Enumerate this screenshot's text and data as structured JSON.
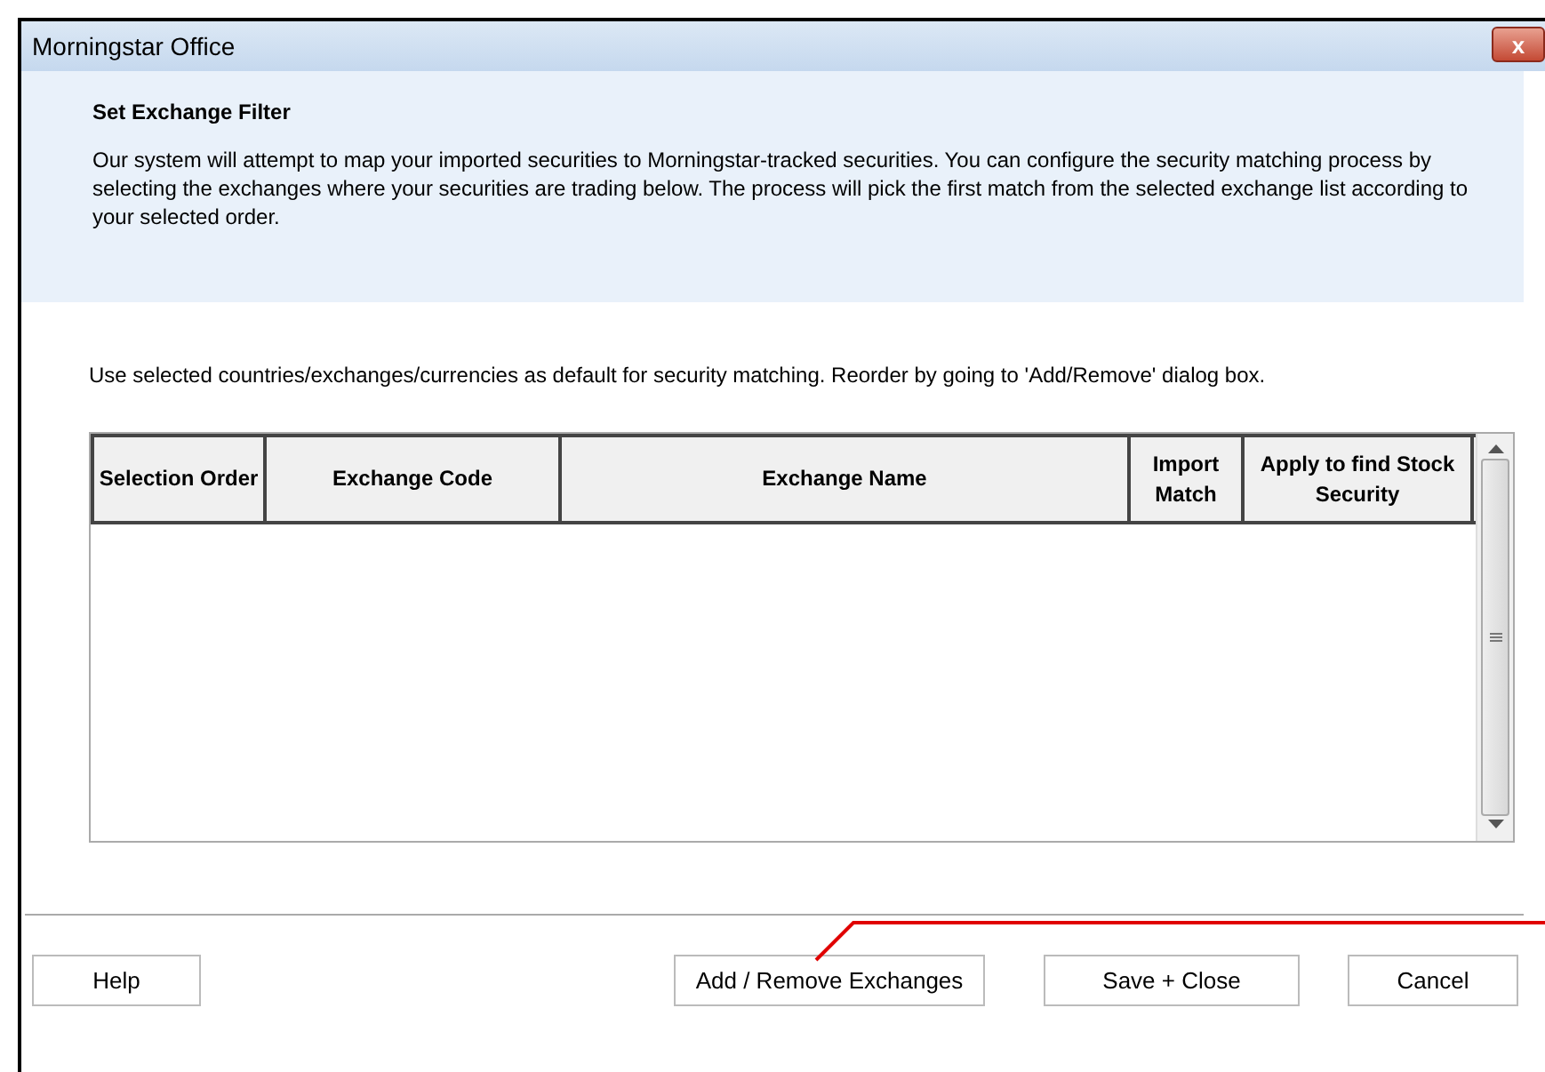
{
  "window": {
    "title": "Morningstar Office",
    "close_label": "x"
  },
  "header": {
    "title": "Set Exchange Filter",
    "description": "Our system will attempt to map your imported securities to Morningstar-tracked securities.  You can configure the security matching process by selecting the exchanges where your securities are trading below.  The process will pick the first match from the selected exchange list according to your selected order."
  },
  "instruction": "Use selected countries/exchanges/currencies as default for security matching. Reorder by going to 'Add/Remove' dialog box.",
  "table": {
    "columns": [
      "Selection Order",
      "Exchange Code",
      "Exchange Name",
      "Import Match",
      "Apply to find Stock Security"
    ]
  },
  "buttons": [
    {
      "label": "Help"
    },
    {
      "label": "Add / Remove Exchanges"
    },
    {
      "label": "Save + Close"
    },
    {
      "label": "Cancel"
    }
  ]
}
